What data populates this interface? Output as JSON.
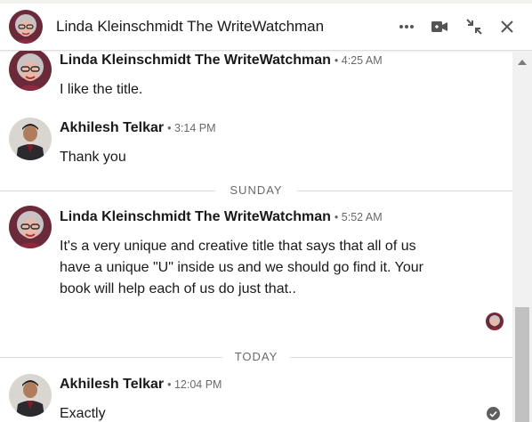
{
  "conversation": {
    "title": "Linda Kleinschmidt The WriteWatchman",
    "icons": {
      "more": "more-icon",
      "video": "video-call-icon",
      "collapse": "collapse-icon",
      "close": "close-icon"
    }
  },
  "messages": [
    {
      "sender": "Linda Kleinschmidt The WriteWatchman",
      "time": "• 4:25 AM",
      "text": "I like the title."
    },
    {
      "sender": "Akhilesh Telkar",
      "time": "• 3:14 PM",
      "text": "Thank you"
    },
    {
      "sender": "Linda Kleinschmidt The WriteWatchman",
      "time": "• 5:52 AM",
      "lines": [
        "It's a very unique and creative title that says that all of us",
        "have a unique \"U\" inside us and we should go find it. Your",
        "book will help each of us do just that.."
      ]
    },
    {
      "sender": "Akhilesh Telkar",
      "time": "• 12:04 PM",
      "text": "Exactly"
    }
  ],
  "dividers": {
    "sunday": "SUNDAY",
    "today": "TODAY"
  },
  "colors": {
    "text": "#191919",
    "muted": "#666666",
    "divider_line": "#dcdcdc",
    "scrollbar_track": "#f1f1f1",
    "scrollbar_thumb": "#c1c1c1"
  }
}
